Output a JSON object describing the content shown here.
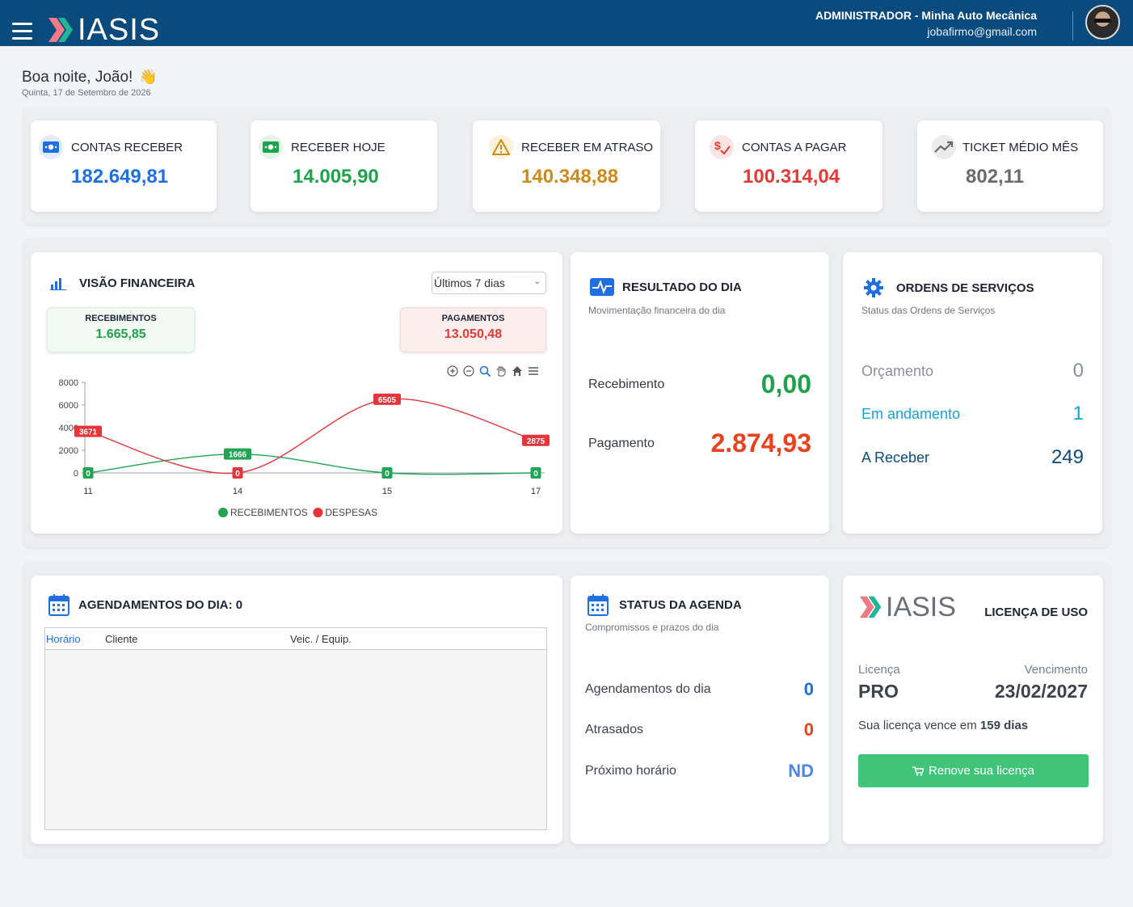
{
  "header": {
    "brand": "IASIS",
    "user_role": "ADMINISTRADOR - Minha Auto Mecânica",
    "user_email": "jobafirmo@gmail.com"
  },
  "greeting": {
    "title": "Boa noite, João!",
    "emoji": "👋",
    "date": "Quinta, 17 de Setembro de 2026"
  },
  "kpis": [
    {
      "label": "CONTAS RECEBER",
      "value": "182.649,81",
      "color": "#1f6fe0",
      "icon": "money-icon"
    },
    {
      "label": "RECEBER HOJE",
      "value": "14.005,90",
      "color": "#1fa34a",
      "icon": "money-icon"
    },
    {
      "label": "RECEBER EM ATRASO",
      "value": "140.348,88",
      "color": "#d08a18",
      "icon": "warning-icon"
    },
    {
      "label": "CONTAS A PAGAR",
      "value": "100.314,04",
      "color": "#e53935",
      "icon": "bill-icon"
    },
    {
      "label": "TICKET MÉDIO MÊS",
      "value": "802,11",
      "color": "#6b6b6b",
      "icon": "trend-icon"
    }
  ],
  "finance": {
    "title": "VISÃO FINANCEIRA",
    "period": "Últimos 7 dias",
    "receipts_label": "RECEBIMENTOS",
    "receipts_value": "1.665,85",
    "payments_label": "PAGAMENTOS",
    "payments_value": "13.050,48"
  },
  "chart_data": {
    "type": "line",
    "categories": [
      "11",
      "14",
      "15",
      "17"
    ],
    "series": [
      {
        "name": "RECEBIMENTOS",
        "values": [
          0,
          1666,
          0,
          0
        ],
        "color": "#22a455"
      },
      {
        "name": "DESPESAS",
        "values": [
          3671,
          0,
          6505,
          2875
        ],
        "color": "#e5343a"
      }
    ],
    "ylim": [
      0,
      8000
    ],
    "yticks": [
      "0",
      "2000",
      "4000",
      "6000",
      "8000"
    ],
    "legend": "bottom"
  },
  "day_result": {
    "title": "RESULTADO DO DIA",
    "subtitle": "Movimentação financeira do dia",
    "receipt_label": "Recebimento",
    "receipt_value": "0,00",
    "payment_label": "Pagamento",
    "payment_value": "2.874,93"
  },
  "orders": {
    "title": "ORDENS DE SERVIÇOS",
    "subtitle": "Status das Ordens de Serviços",
    "items": [
      {
        "label": "Orçamento",
        "value": "0",
        "color": "#8a9099"
      },
      {
        "label": "Em andamento",
        "value": "1",
        "color": "#12a3dc"
      },
      {
        "label": "A Receber",
        "value": "249",
        "color": "#0b4a7d"
      }
    ]
  },
  "appointments": {
    "title": "AGENDAMENTOS DO DIA: 0",
    "columns": [
      "Horário",
      "Cliente",
      "Veic. / Equip."
    ]
  },
  "agenda": {
    "title": "STATUS DA AGENDA",
    "subtitle": "Compromissos e prazos do dia",
    "items": [
      {
        "label": "Agendamentos do dia",
        "value": "0",
        "color": "#1f6fe0"
      },
      {
        "label": "Atrasados",
        "value": "0",
        "color": "#e8421e"
      },
      {
        "label": "Próximo horário",
        "value": "ND",
        "color": "#4b86e8"
      }
    ]
  },
  "license": {
    "brand": "IASIS",
    "title": "LICENÇA DE USO",
    "plan_label": "Licença",
    "plan_value": "PRO",
    "due_label": "Vencimento",
    "due_value": "23/02/2027",
    "notice_prefix": "Sua licença vence em",
    "notice_days": "159 dias",
    "button": "Renove sua licença"
  }
}
